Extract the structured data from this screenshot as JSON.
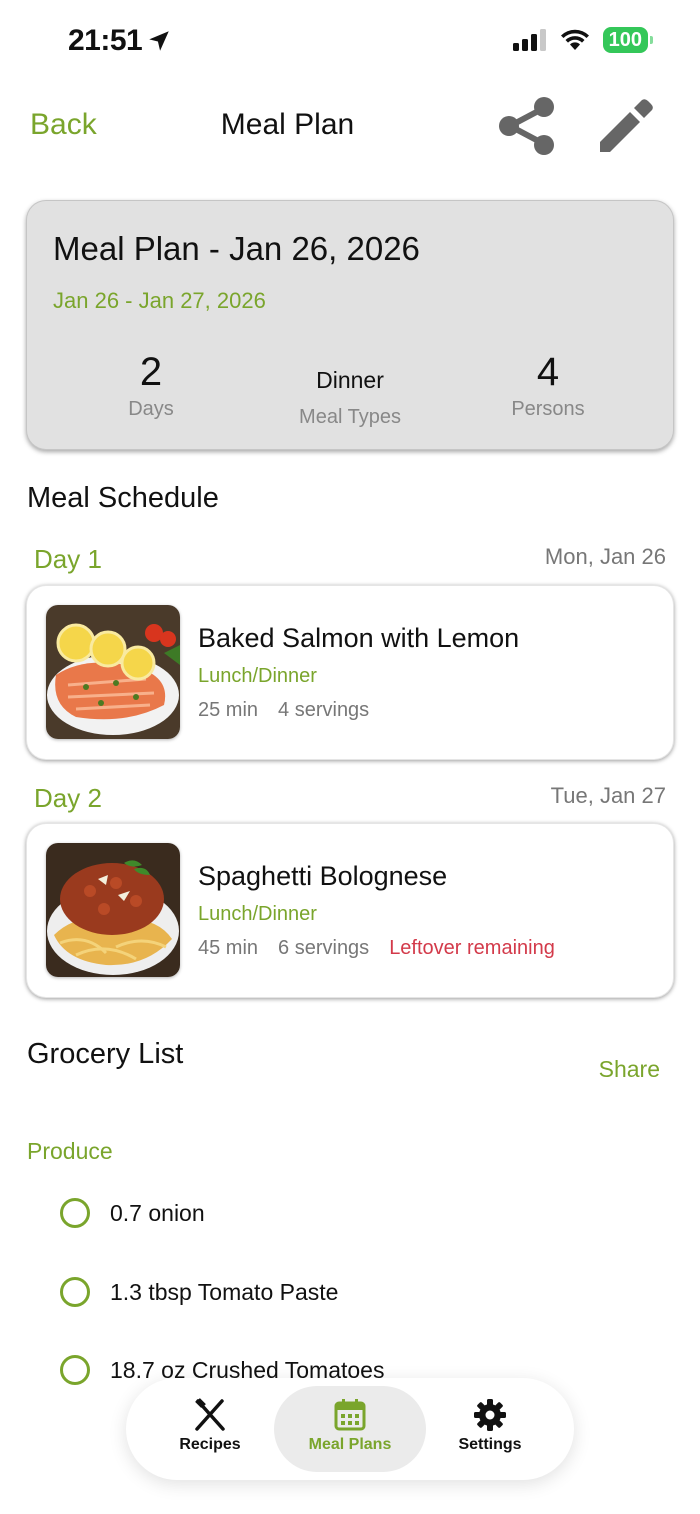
{
  "status_bar": {
    "time": "21:51",
    "battery": "100"
  },
  "nav": {
    "back_label": "Back",
    "title": "Meal Plan",
    "share_icon": "share-icon",
    "edit_icon": "pencil-icon"
  },
  "summary": {
    "title": "Meal Plan - Jan 26, 2026",
    "range": "Jan 26 - Jan 27, 2026",
    "stats": [
      {
        "value": "2",
        "label": "Days"
      },
      {
        "value": "Dinner",
        "label": "Meal Types"
      },
      {
        "value": "4",
        "label": "Persons"
      }
    ]
  },
  "schedule": {
    "title": "Meal Schedule",
    "days": [
      {
        "label": "Day 1",
        "date": "Mon, Jan 26",
        "meal": {
          "name": "Baked Salmon with Lemon",
          "type": "Lunch/Dinner",
          "time": "25 min",
          "servings": "4 servings",
          "note": ""
        }
      },
      {
        "label": "Day 2",
        "date": "Tue, Jan 27",
        "meal": {
          "name": "Spaghetti Bolognese",
          "type": "Lunch/Dinner",
          "time": "45 min",
          "servings": "6 servings",
          "note": "Leftover remaining"
        }
      }
    ]
  },
  "grocery": {
    "title": "Grocery List",
    "share_label": "Share",
    "category": "Produce",
    "items": [
      "0.7 onion",
      "1.3 tbsp Tomato Paste",
      "18.7 oz Crushed Tomatoes"
    ]
  },
  "tabs": [
    {
      "label": "Recipes",
      "icon": "fork-knife-icon",
      "active": false
    },
    {
      "label": "Meal Plans",
      "icon": "calendar-icon",
      "active": true
    },
    {
      "label": "Settings",
      "icon": "gear-icon",
      "active": false
    }
  ],
  "colors": {
    "accent": "#7aa52c",
    "leftover": "#d33a4a",
    "card_bg": "#e1e1e1",
    "battery": "#34c759"
  }
}
